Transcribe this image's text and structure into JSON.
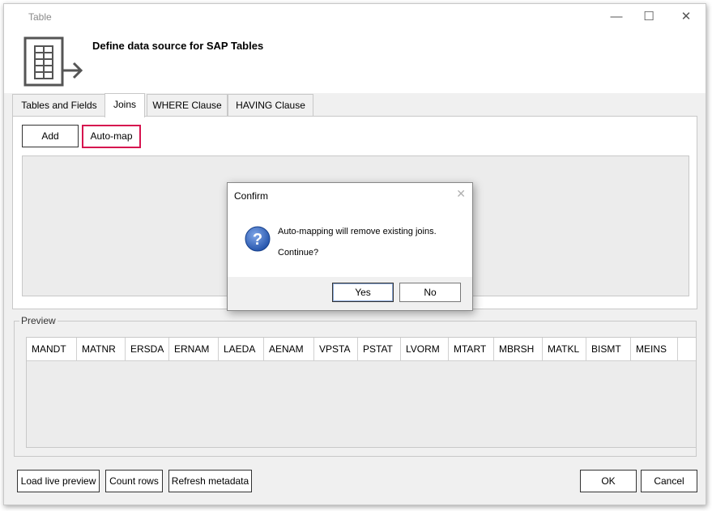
{
  "window": {
    "title": "Table",
    "controls": {
      "minimize": "—",
      "maximize": "☐",
      "close": "✕"
    }
  },
  "header": {
    "title": "Define data source for SAP Tables",
    "icon": "table-export-icon"
  },
  "tabs": [
    {
      "label": "Tables and Fields",
      "active": false
    },
    {
      "label": "Joins",
      "active": true
    },
    {
      "label": "WHERE Clause",
      "active": false
    },
    {
      "label": "HAVING Clause",
      "active": false
    }
  ],
  "joins": {
    "add_label": "Add",
    "automap_label": "Auto-map"
  },
  "preview": {
    "legend": "Preview",
    "columns": [
      "MANDT",
      "MATNR",
      "ERSDA",
      "ERNAM",
      "LAEDA",
      "AENAM",
      "VPSTA",
      "PSTAT",
      "LVORM",
      "MTART",
      "MBRSH",
      "MATKL",
      "BISMT",
      "MEINS"
    ]
  },
  "footer": {
    "load_preview": "Load live preview",
    "count_rows": "Count rows",
    "refresh_metadata": "Refresh metadata",
    "ok": "OK",
    "cancel": "Cancel"
  },
  "dialog": {
    "title": "Confirm",
    "close": "✕",
    "icon": "question-icon",
    "message_line1": "Auto-mapping will remove existing joins.",
    "message_line2": "Continue?",
    "yes": "Yes",
    "no": "No"
  },
  "colors": {
    "highlight": "#d6134f",
    "question_icon": "#1f4fa8"
  }
}
